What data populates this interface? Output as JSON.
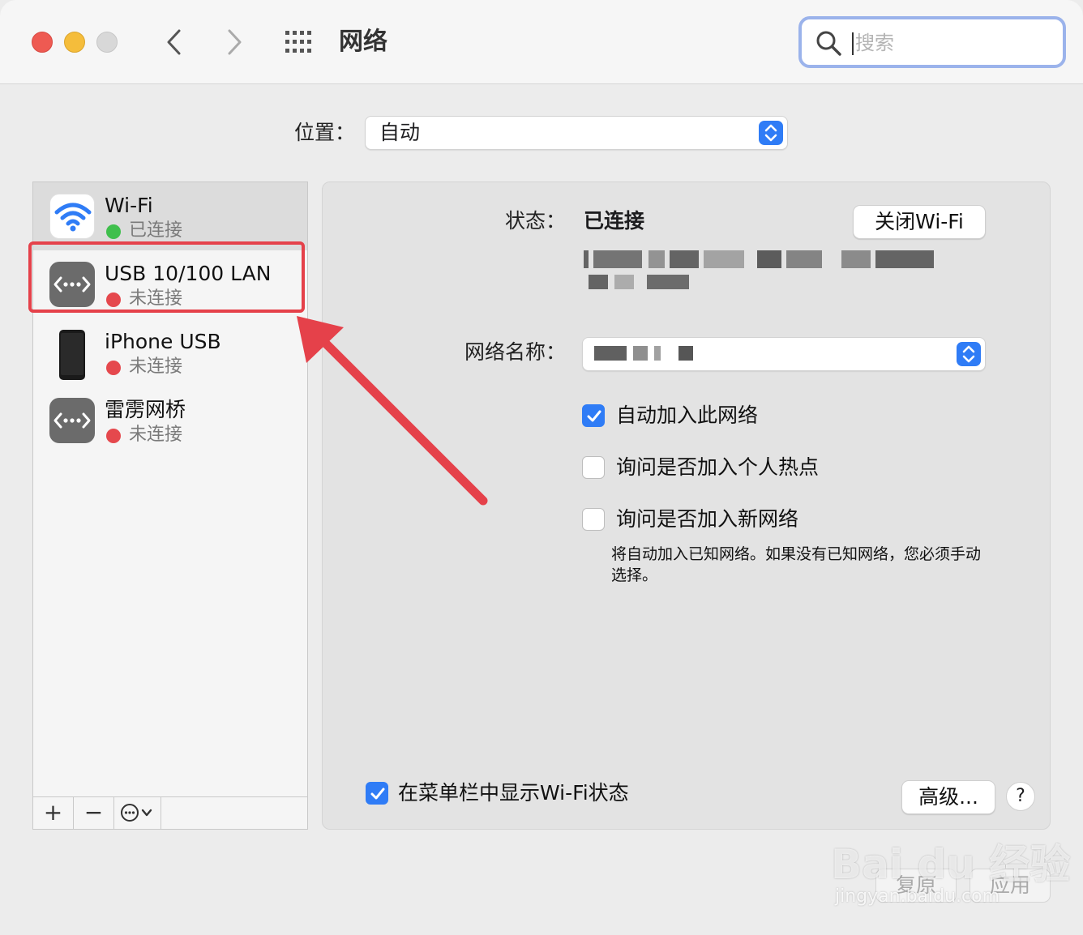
{
  "window": {
    "title": "网络"
  },
  "toolbar": {
    "search": {
      "placeholder": "搜索",
      "value": ""
    }
  },
  "location": {
    "label": "位置：",
    "value": "自动"
  },
  "sidebar": {
    "services": [
      {
        "name": "Wi-Fi",
        "status": "已连接",
        "status_color": "#3fbf4c",
        "icon": "wifi-icon"
      },
      {
        "name": "USB 10/100 LAN",
        "status": "未连接",
        "status_color": "#e5484d",
        "icon": "ethernet-icon"
      },
      {
        "name": "iPhone USB",
        "status": "未连接",
        "status_color": "#e5484d",
        "icon": "iphone-icon"
      },
      {
        "name": "雷雳网桥",
        "status": "未连接",
        "status_color": "#e5484d",
        "icon": "ethernet-icon"
      }
    ],
    "buttons": {
      "add": "+",
      "remove": "−"
    }
  },
  "detail": {
    "status_label": "状态：",
    "status_value": "已连接",
    "turn_off_button": "关闭Wi-Fi",
    "network_name_label": "网络名称：",
    "checkboxes": [
      {
        "label": "自动加入此网络",
        "checked": true
      },
      {
        "label": "询问是否加入个人热点",
        "checked": false
      },
      {
        "label": "询问是否加入新网络",
        "checked": false
      }
    ],
    "note": "将自动加入已知网络。如果没有已知网络，您必须手动选择。",
    "show_in_menubar": {
      "label": "在菜单栏中显示Wi-Fi状态",
      "checked": true
    },
    "advanced_button": "高级...",
    "help_button": "?"
  },
  "footer": {
    "revert": "复原",
    "apply": "应用"
  },
  "watermark": {
    "brand": "Bai du 经验",
    "url": "jingyan.baidu.com"
  },
  "colors": {
    "accent": "#2f7cf6",
    "highlight": "#e5414a"
  }
}
